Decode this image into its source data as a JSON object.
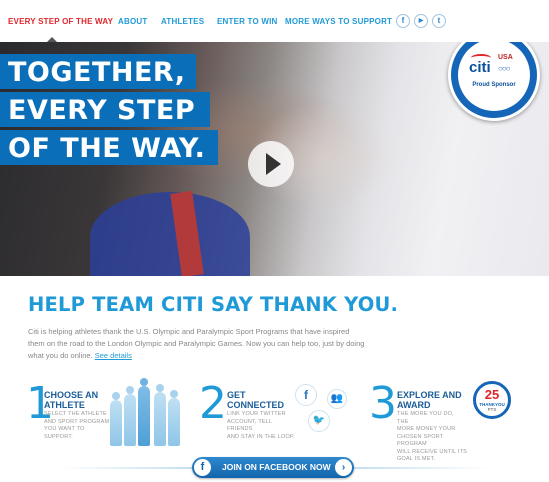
{
  "nav": {
    "items": [
      {
        "label": "EVERY STEP OF THE WAY",
        "active": true
      },
      {
        "label": "ABOUT",
        "active": false
      },
      {
        "label": "ATHLETES",
        "active": false
      },
      {
        "label": "ENTER TO WIN",
        "active": false
      },
      {
        "label": "MORE WAYS TO SUPPORT",
        "active": false
      }
    ],
    "social": [
      {
        "icon": "facebook-icon",
        "glyph": "f"
      },
      {
        "icon": "youtube-icon",
        "glyph": "▶"
      },
      {
        "icon": "twitter-icon",
        "glyph": "t"
      }
    ]
  },
  "hero": {
    "headline_lines": [
      "TOGETHER,",
      "EVERY STEP",
      "OF THE WAY."
    ],
    "play_icon": "play-icon",
    "badge": {
      "brand": "citi",
      "team": "USA",
      "tagline": "Proud Sponsor"
    }
  },
  "main": {
    "title": "HELP TEAM CITI SAY THANK YOU.",
    "intro": "Citi is helping athletes thank the U.S. Olympic and Paralympic Sport Programs that have inspired them on the road to the London Olympic and Paralympic Games. Now you can help too, just by doing what you do online.",
    "intro_link": "See details"
  },
  "steps": [
    {
      "number": "1",
      "title": "CHOOSE AN\nATHLETE",
      "desc": "SELECT THE ATHLETE\nAND SPORT PROGRAM\nYOU WANT TO SUPPORT."
    },
    {
      "number": "2",
      "title": "GET\nCONNECTED",
      "desc": "LINK YOUR TWITTER\nACCOUNT, TELL FRIENDS\nAND STAY IN THE LOOP."
    },
    {
      "number": "3",
      "title": "EXPLORE AND\nAWARD",
      "desc": "THE MORE YOU DO, THE\nMORE MONEY YOUR\nCHOSEN SPORT PROGRAM\nWILL RECEIVE UNTIL ITS\nGOAL IS MET."
    }
  ],
  "score_badge": {
    "value": "25",
    "label": "THANKYOU",
    "unit": "PTS"
  },
  "cta": {
    "label": "JOIN ON FACEBOOK NOW",
    "icon": "facebook-icon",
    "arrow": "chevron-right-icon"
  },
  "colors": {
    "accent_blue": "#1f9ad6",
    "dark_blue": "#0a6fb8",
    "active_red": "#e0252b"
  }
}
